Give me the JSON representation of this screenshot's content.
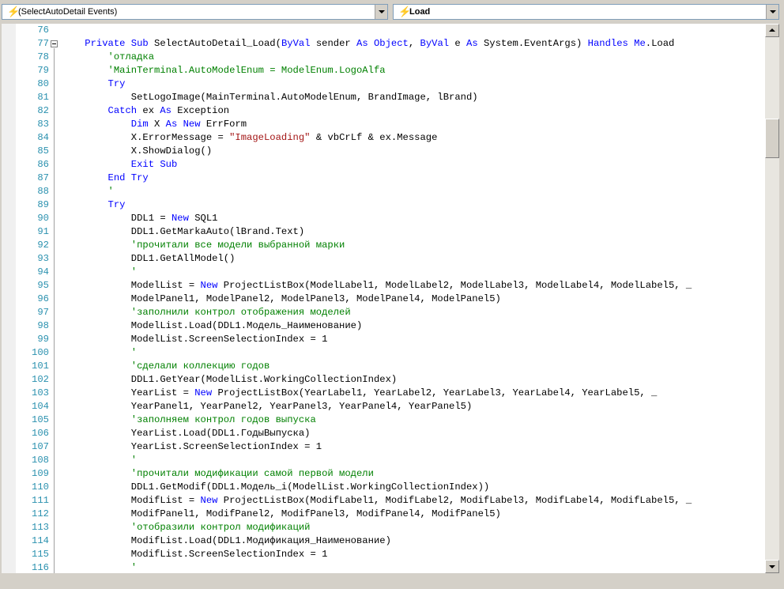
{
  "class_dropdown": {
    "label": "(SelectAutoDetail Events)",
    "icon": "lightning-icon"
  },
  "method_dropdown": {
    "label": "Load",
    "icon": "lightning-icon"
  },
  "colors": {
    "keyword": "#0000ff",
    "comment": "#008000",
    "string": "#a31515",
    "line_number": "#2b91af"
  },
  "code_lines": [
    {
      "n": "76",
      "tokens": []
    },
    {
      "n": "77",
      "tokens": [
        {
          "t": "kw",
          "v": "    Private Sub "
        },
        {
          "t": "tx",
          "v": "SelectAutoDetail_Load("
        },
        {
          "t": "kw",
          "v": "ByVal"
        },
        {
          "t": "tx",
          "v": " sender "
        },
        {
          "t": "kw",
          "v": "As Object"
        },
        {
          "t": "tx",
          "v": ", "
        },
        {
          "t": "kw",
          "v": "ByVal"
        },
        {
          "t": "tx",
          "v": " e "
        },
        {
          "t": "kw",
          "v": "As"
        },
        {
          "t": "tx",
          "v": " System.EventArgs) "
        },
        {
          "t": "kw",
          "v": "Handles Me"
        },
        {
          "t": "tx",
          "v": ".Load"
        }
      ]
    },
    {
      "n": "78",
      "tokens": [
        {
          "t": "cm",
          "v": "        'отладка"
        }
      ]
    },
    {
      "n": "79",
      "tokens": [
        {
          "t": "cm",
          "v": "        'MainTerminal.AutoModelEnum = ModelEnum.LogoAlfa"
        }
      ]
    },
    {
      "n": "80",
      "tokens": [
        {
          "t": "kw",
          "v": "        Try"
        }
      ]
    },
    {
      "n": "81",
      "tokens": [
        {
          "t": "tx",
          "v": "            SetLogoImage(MainTerminal.AutoModelEnum, BrandImage, lBrand)"
        }
      ]
    },
    {
      "n": "82",
      "tokens": [
        {
          "t": "kw",
          "v": "        Catch"
        },
        {
          "t": "tx",
          "v": " ex "
        },
        {
          "t": "kw",
          "v": "As"
        },
        {
          "t": "tx",
          "v": " Exception"
        }
      ]
    },
    {
      "n": "83",
      "tokens": [
        {
          "t": "kw",
          "v": "            Dim"
        },
        {
          "t": "tx",
          "v": " X "
        },
        {
          "t": "kw",
          "v": "As New"
        },
        {
          "t": "tx",
          "v": " ErrForm"
        }
      ]
    },
    {
      "n": "84",
      "tokens": [
        {
          "t": "tx",
          "v": "            X.ErrorMessage = "
        },
        {
          "t": "st",
          "v": "\"ImageLoading\""
        },
        {
          "t": "tx",
          "v": " & vbCrLf & ex.Message"
        }
      ]
    },
    {
      "n": "85",
      "tokens": [
        {
          "t": "tx",
          "v": "            X.ShowDialog()"
        }
      ]
    },
    {
      "n": "86",
      "tokens": [
        {
          "t": "kw",
          "v": "            Exit Sub"
        }
      ]
    },
    {
      "n": "87",
      "tokens": [
        {
          "t": "kw",
          "v": "        End Try"
        }
      ]
    },
    {
      "n": "88",
      "tokens": [
        {
          "t": "cm",
          "v": "        '"
        }
      ]
    },
    {
      "n": "89",
      "tokens": [
        {
          "t": "kw",
          "v": "        Try"
        }
      ]
    },
    {
      "n": "90",
      "tokens": [
        {
          "t": "tx",
          "v": "            DDL1 = "
        },
        {
          "t": "kw",
          "v": "New"
        },
        {
          "t": "tx",
          "v": " SQL1"
        }
      ]
    },
    {
      "n": "91",
      "tokens": [
        {
          "t": "tx",
          "v": "            DDL1.GetMarkaAuto(lBrand.Text)"
        }
      ]
    },
    {
      "n": "92",
      "tokens": [
        {
          "t": "cm",
          "v": "            'прочитали все модели выбранной марки"
        }
      ]
    },
    {
      "n": "93",
      "tokens": [
        {
          "t": "tx",
          "v": "            DDL1.GetAllModel()"
        }
      ]
    },
    {
      "n": "94",
      "tokens": [
        {
          "t": "cm",
          "v": "            '"
        }
      ]
    },
    {
      "n": "95",
      "tokens": [
        {
          "t": "tx",
          "v": "            ModelList = "
        },
        {
          "t": "kw",
          "v": "New"
        },
        {
          "t": "tx",
          "v": " ProjectListBox(ModelLabel1, ModelLabel2, ModelLabel3, ModelLabel4, ModelLabel5, _"
        }
      ]
    },
    {
      "n": "96",
      "tokens": [
        {
          "t": "tx",
          "v": "            ModelPanel1, ModelPanel2, ModelPanel3, ModelPanel4, ModelPanel5)"
        }
      ]
    },
    {
      "n": "97",
      "tokens": [
        {
          "t": "cm",
          "v": "            'заполнили контрол отображения моделей"
        }
      ]
    },
    {
      "n": "98",
      "tokens": [
        {
          "t": "tx",
          "v": "            ModelList.Load(DDL1.Модель_Наименование)"
        }
      ]
    },
    {
      "n": "99",
      "tokens": [
        {
          "t": "tx",
          "v": "            ModelList.ScreenSelectionIndex = 1"
        }
      ]
    },
    {
      "n": "100",
      "tokens": [
        {
          "t": "cm",
          "v": "            '"
        }
      ]
    },
    {
      "n": "101",
      "tokens": [
        {
          "t": "cm",
          "v": "            'сделали коллекцию годов"
        }
      ]
    },
    {
      "n": "102",
      "tokens": [
        {
          "t": "tx",
          "v": "            DDL1.GetYear(ModelList.WorkingCollectionIndex)"
        }
      ]
    },
    {
      "n": "103",
      "tokens": [
        {
          "t": "tx",
          "v": "            YearList = "
        },
        {
          "t": "kw",
          "v": "New"
        },
        {
          "t": "tx",
          "v": " ProjectListBox(YearLabel1, YearLabel2, YearLabel3, YearLabel4, YearLabel5, _"
        }
      ]
    },
    {
      "n": "104",
      "tokens": [
        {
          "t": "tx",
          "v": "            YearPanel1, YearPanel2, YearPanel3, YearPanel4, YearPanel5)"
        }
      ]
    },
    {
      "n": "105",
      "tokens": [
        {
          "t": "cm",
          "v": "            'заполняем контрол годов выпуска"
        }
      ]
    },
    {
      "n": "106",
      "tokens": [
        {
          "t": "tx",
          "v": "            YearList.Load(DDL1.ГодыВыпуска)"
        }
      ]
    },
    {
      "n": "107",
      "tokens": [
        {
          "t": "tx",
          "v": "            YearList.ScreenSelectionIndex = 1"
        }
      ]
    },
    {
      "n": "108",
      "tokens": [
        {
          "t": "cm",
          "v": "            '"
        }
      ]
    },
    {
      "n": "109",
      "tokens": [
        {
          "t": "cm",
          "v": "            'прочитали модификации самой первой модели"
        }
      ]
    },
    {
      "n": "110",
      "tokens": [
        {
          "t": "tx",
          "v": "            DDL1.GetModif(DDL1.Модель_i(ModelList.WorkingCollectionIndex))"
        }
      ]
    },
    {
      "n": "111",
      "tokens": [
        {
          "t": "tx",
          "v": "            ModifList = "
        },
        {
          "t": "kw",
          "v": "New"
        },
        {
          "t": "tx",
          "v": " ProjectListBox(ModifLabel1, ModifLabel2, ModifLabel3, ModifLabel4, ModifLabel5, _"
        }
      ]
    },
    {
      "n": "112",
      "tokens": [
        {
          "t": "tx",
          "v": "            ModifPanel1, ModifPanel2, ModifPanel3, ModifPanel4, ModifPanel5)"
        }
      ]
    },
    {
      "n": "113",
      "tokens": [
        {
          "t": "cm",
          "v": "            'отобразили контрол модификаций"
        }
      ]
    },
    {
      "n": "114",
      "tokens": [
        {
          "t": "tx",
          "v": "            ModifList.Load(DDL1.Модификация_Наименование)"
        }
      ]
    },
    {
      "n": "115",
      "tokens": [
        {
          "t": "tx",
          "v": "            ModifList.ScreenSelectionIndex = 1"
        }
      ]
    },
    {
      "n": "116",
      "tokens": [
        {
          "t": "cm",
          "v": "            '"
        }
      ]
    }
  ]
}
